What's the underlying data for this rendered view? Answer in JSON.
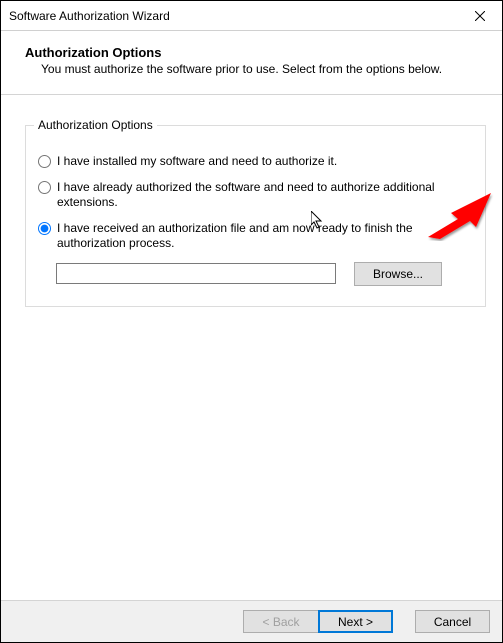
{
  "window": {
    "title": "Software Authorization Wizard"
  },
  "header": {
    "title": "Authorization Options",
    "subtitle": "You must authorize the software prior to use. Select from the options below."
  },
  "group": {
    "legend": "Authorization Options",
    "options": [
      {
        "label": "I have installed my software and need to authorize it.",
        "checked": false
      },
      {
        "label": "I have already authorized the software and need to authorize additional extensions.",
        "checked": false
      },
      {
        "label": "I have received an authorization file and am now ready to finish the authorization process.",
        "checked": true
      }
    ],
    "file_value": "",
    "browse_label": "Browse..."
  },
  "buttons": {
    "back": "< Back",
    "next": "Next >",
    "cancel": "Cancel"
  }
}
